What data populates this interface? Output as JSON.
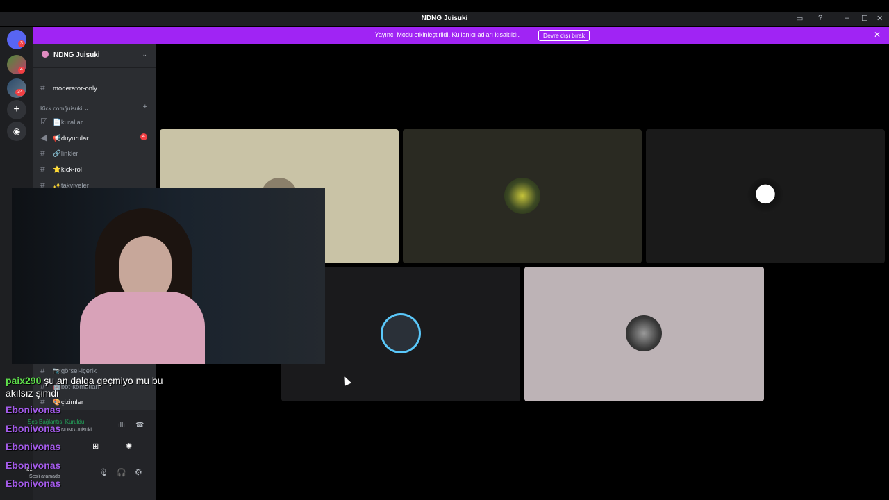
{
  "window": {
    "title": "NDNG Juisuki"
  },
  "banner": {
    "message": "Yayıncı Modu etkinleştirildi. Kullanıcı adları kısaltıldı.",
    "button": "Devre dışı bırak"
  },
  "servers": {
    "badges": [
      "3",
      "4",
      "34"
    ]
  },
  "sidebar": {
    "guild_name": "NDNG Juisuki",
    "channels_top": [
      "moderator-only"
    ],
    "category": "Kick.com/juisuki",
    "channels": [
      {
        "label": "📄kurallar",
        "icon": "rules-icon"
      },
      {
        "label": "📢duyurular",
        "badge": "4",
        "icon": "announcement-icon"
      },
      {
        "label": "🔗linkler",
        "icon": "hash-icon"
      },
      {
        "label": "⭐kick-rol",
        "icon": "hash-icon"
      },
      {
        "label": "✨takviyeler",
        "icon": "hash-icon"
      }
    ],
    "lower_channels": [
      "📷görsel-içerik",
      "🤖bot-komutları",
      "🎨çizimler"
    ],
    "voice": {
      "status": "Ses Bağlantısı Kuruldu",
      "server": "NDNG Juisuki"
    },
    "user": {
      "status": "Sesli aramada",
      "name": "I..."
    }
  },
  "chat_overlay": {
    "messages": [
      {
        "user": "paix290",
        "text": "şu an dalga geçmiyo mu bu akılsız şimdi"
      },
      {
        "user": "Ebonivonas",
        "text": ""
      },
      {
        "user": "Ebonivonas",
        "text": ""
      },
      {
        "user": "Ebonivonas",
        "text": ""
      },
      {
        "user": "Ebonivonas",
        "text": ""
      },
      {
        "user": "Ebonivonas",
        "text": ""
      }
    ],
    "colors": {
      "paix": "#5fe04b",
      "ebon": "#a45bea"
    }
  },
  "colors": {
    "banner": "#a024f4",
    "sidebar": "#2b2d31",
    "rail": "#1e1f22"
  }
}
